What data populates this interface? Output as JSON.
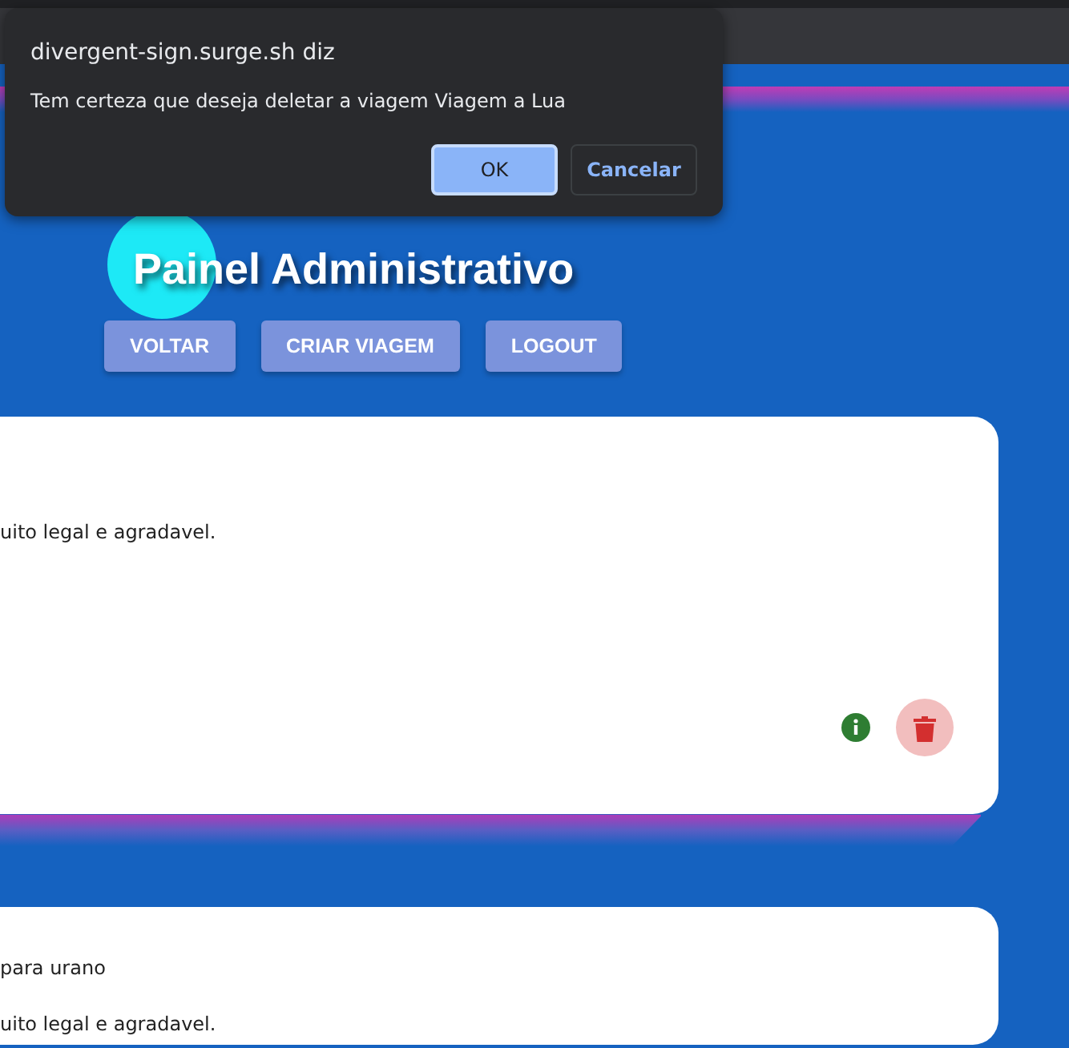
{
  "dialog": {
    "title": "divergent-sign.surge.sh diz",
    "message": "Tem certeza que deseja deletar a viagem Viagem a Lua",
    "buttons": [
      {
        "label": "OK",
        "kind": "primary"
      },
      {
        "label": "Cancelar",
        "kind": "secondary"
      }
    ]
  },
  "header": {
    "title": "Painel Administrativo",
    "buttons": [
      "VOLTAR",
      "CRIAR VIAGEM",
      "LOGOUT"
    ]
  },
  "trips": [
    {
      "lines": [
        "uito legal e agradavel."
      ],
      "actions": true
    },
    {
      "lines": [
        "para urano",
        "uito legal e agradavel."
      ]
    }
  ]
}
